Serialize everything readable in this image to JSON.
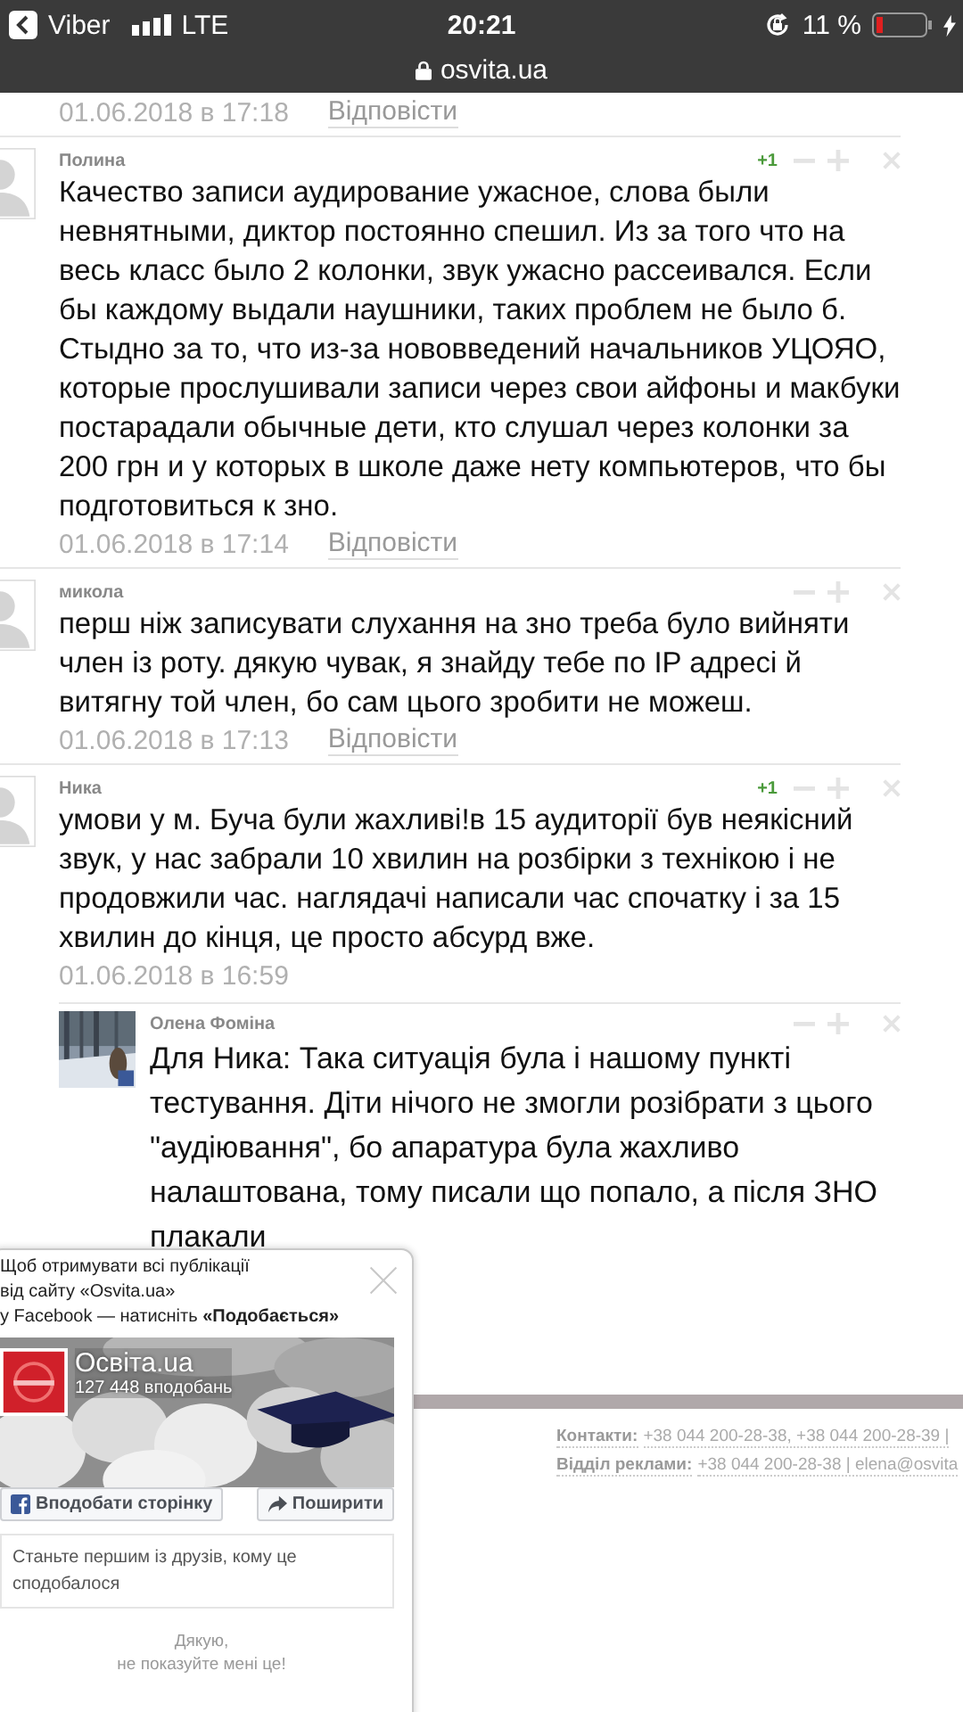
{
  "status_bar": {
    "back_label": "Viber",
    "network": "LTE",
    "time": "20:21",
    "battery": "11 %"
  },
  "address_bar": {
    "url": "osvita.ua"
  },
  "previous_comment_footer": {
    "date": "01.06.2018 в 17:18",
    "reply": "Відповісти"
  },
  "comments": [
    {
      "author": "Полина",
      "score": "+1",
      "text": "Качество записи аудирование ужасное, слова были невнятными, диктор постоянно спешил. Из за того что на весь класс было 2 колонки, звук ужасно рассеивался. Если бы каждому выдали наушники, таких проблем не было б. Стыдно за то, что из-за нововведений начальников УЦОЯО, которые прослушивали записи через свои айфоны и макбуки постарадали обычные дети, кто слушал через колонки за 200 грн и у которых в школе даже нету компьютеров, что бы подготовиться к зно.",
      "date": "01.06.2018 в 17:14",
      "reply": "Відповісти"
    },
    {
      "author": "микола",
      "text": "перш ніж записувати слухання на зно треба було вийняти член із роту. дякую чувак, я знайду тебе по IP адресі й витягну той член, бо сам цього зробити не можеш.",
      "date": "01.06.2018 в 17:13",
      "reply": "Відповісти"
    },
    {
      "author": "Ника",
      "score": "+1",
      "text": "умови у м. Буча були жахливі!в 15 аудиторії був неякісний звук, у нас забрали 10 хвилин на розбірки з технікою і не продовжили час. наглядачі написали час спочатку і за 15 хвилин до кінця, це просто абсурд вже.",
      "date": "01.06.2018 в 16:59",
      "replies": [
        {
          "author": "Олена Фоміна",
          "text": "Для Ника: Така ситуація була і нашому пункті тестування. Діти нічого не змогли розібрати з цього \"аудіювання\", бо апаратура була жахливо налаштована, тому писали що попало, а після ЗНО плакали"
        }
      ]
    }
  ],
  "footer": {
    "lines": [
      {
        "label": "Контакти:",
        "text": "+38 044 200-28-38, +38 044 200-28-39 |"
      },
      {
        "label": "Відділ реклами:",
        "text": "+38 044 200-28-38 | elena@osvita"
      }
    ]
  },
  "facebook_popup": {
    "message_lines": [
      "Щоб отримувати всі публікації",
      "від сайту «Osvita.ua»",
      "у Facebook — натисніть **«Подобається»**"
    ],
    "page_name": "Освіта.ua",
    "likes": "127 448 вподобань",
    "like_button": "Вподобати сторінку",
    "share_button": "Поширити",
    "friends_note": "Станьте першим із друзів, кому це сподобалося",
    "dismiss_lines": [
      "Дякую,",
      "не показуйте мені це!"
    ]
  }
}
